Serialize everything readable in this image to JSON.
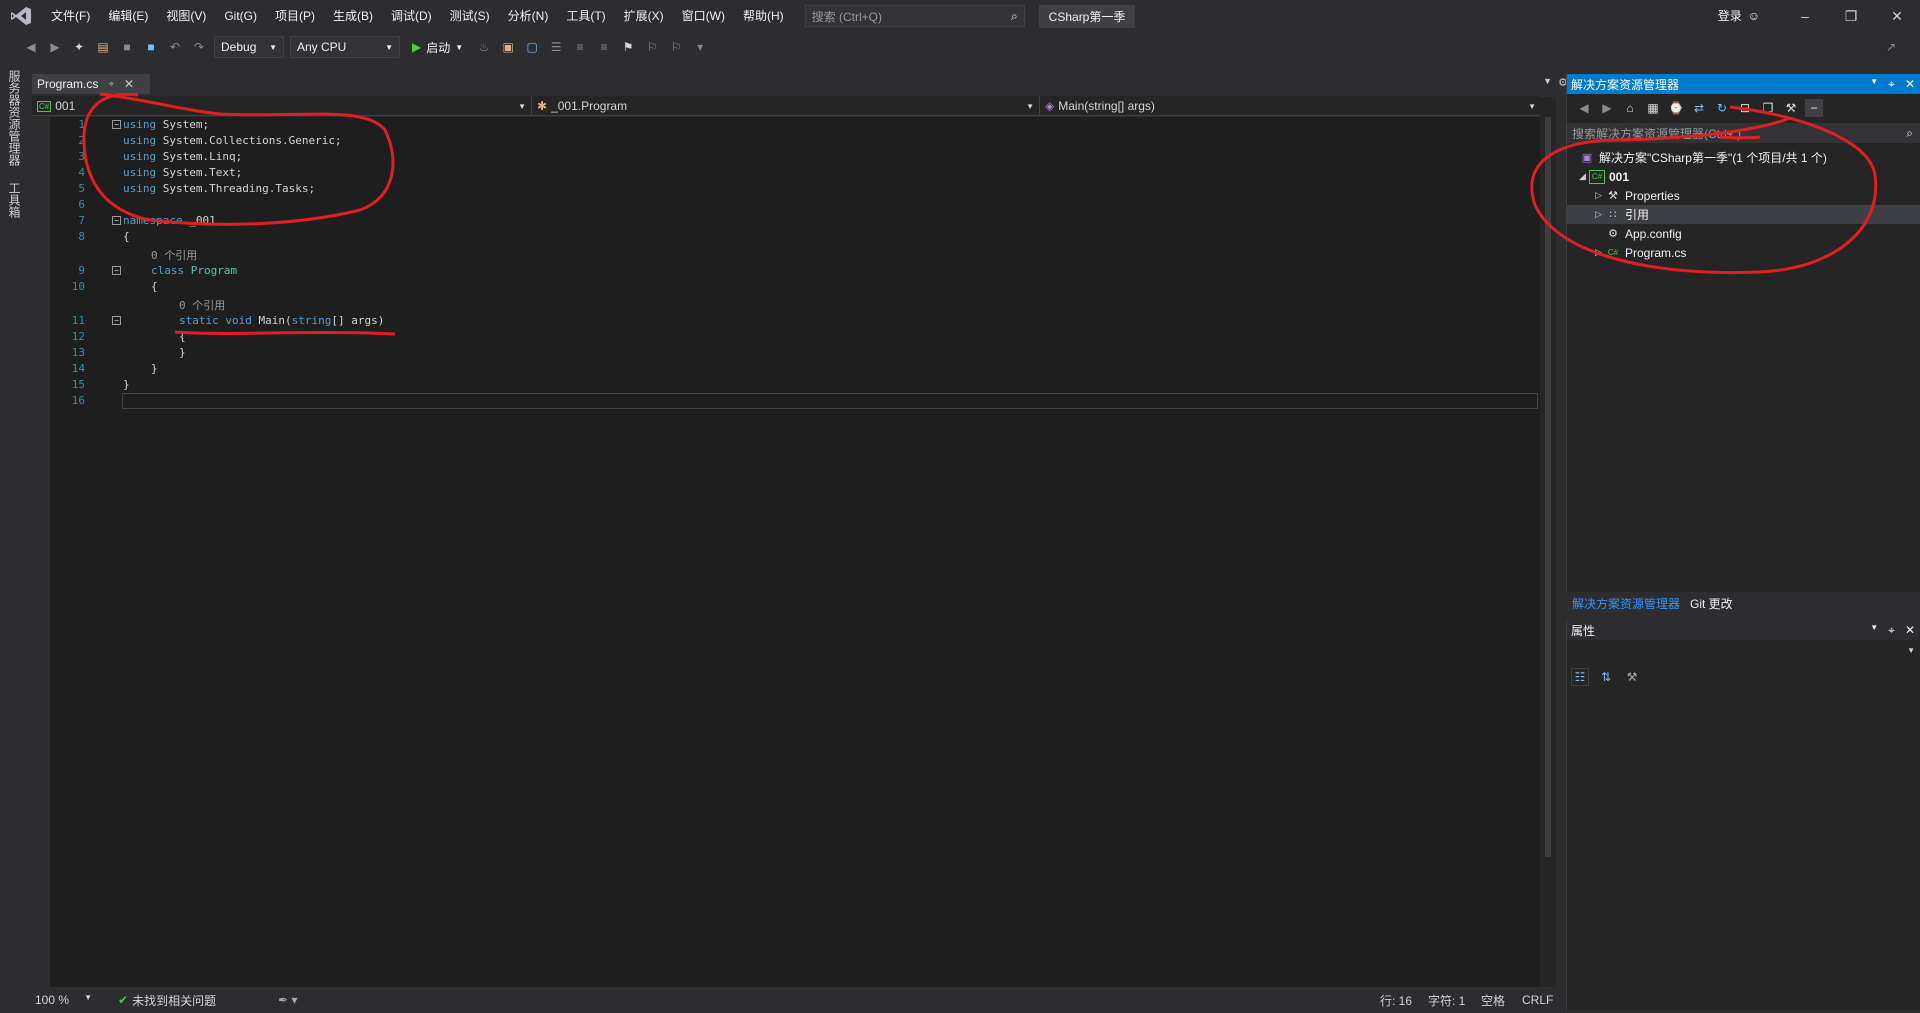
{
  "menu": {
    "items": [
      "文件(F)",
      "编辑(E)",
      "视图(V)",
      "Git(G)",
      "项目(P)",
      "生成(B)",
      "调试(D)",
      "测试(S)",
      "分析(N)",
      "工具(T)",
      "扩展(X)",
      "窗口(W)",
      "帮助(H)"
    ],
    "search_placeholder": "搜索 (Ctrl+Q)",
    "solution_name": "CSharp第一季",
    "login": "登录"
  },
  "toolbar": {
    "config": "Debug",
    "platform": "Any CPU",
    "start_label": "启动"
  },
  "left_rail": {
    "tab1": "服务器资源管理器",
    "tab2": "工具箱"
  },
  "editor": {
    "tab_title": "Program.cs",
    "nav_project": "001",
    "nav_class": "_001.Program",
    "nav_member": "Main(string[] args)",
    "lines": [
      {
        "n": "1",
        "code": "using System;"
      },
      {
        "n": "2",
        "code": "using System.Collections.Generic;"
      },
      {
        "n": "3",
        "code": "using System.Linq;"
      },
      {
        "n": "4",
        "code": "using System.Text;"
      },
      {
        "n": "5",
        "code": "using System.Threading.Tasks;"
      },
      {
        "n": "6",
        "code": ""
      },
      {
        "n": "7",
        "code": "namespace _001"
      },
      {
        "n": "8",
        "code": "{"
      },
      {
        "n": "9",
        "code": "class Program"
      },
      {
        "n": "10",
        "code": "{"
      },
      {
        "n": "11",
        "code": "static void Main(string[] args)"
      },
      {
        "n": "12",
        "code": "{"
      },
      {
        "n": "13",
        "code": "}"
      },
      {
        "n": "14",
        "code": "}"
      },
      {
        "n": "15",
        "code": "}"
      },
      {
        "n": "16",
        "code": ""
      }
    ],
    "lens_class": "0 个引用",
    "lens_method": "0 个引用"
  },
  "status": {
    "zoom": "100 %",
    "issues": "未找到相关问题",
    "line": "行: 16",
    "char": "字符: 1",
    "space": "空格",
    "eol": "CRLF"
  },
  "solution_explorer": {
    "title": "解决方案资源管理器",
    "search_placeholder": "搜索解决方案资源管理器(Ctrl+;)",
    "solution_node": "解决方案\"CSharp第一季\"(1 个项目/共 1 个)",
    "project_node": "001",
    "items": [
      "Properties",
      "引用",
      "App.config",
      "Program.cs"
    ],
    "bottom_tab_active": "解决方案资源管理器",
    "bottom_tab_other": "Git 更改"
  },
  "properties": {
    "title": "属性"
  },
  "colors": {
    "accent": "#007acc",
    "keyword": "#569cd6",
    "type": "#4ec9b0",
    "line_number": "#2b91af",
    "annotation": "#e02020"
  }
}
